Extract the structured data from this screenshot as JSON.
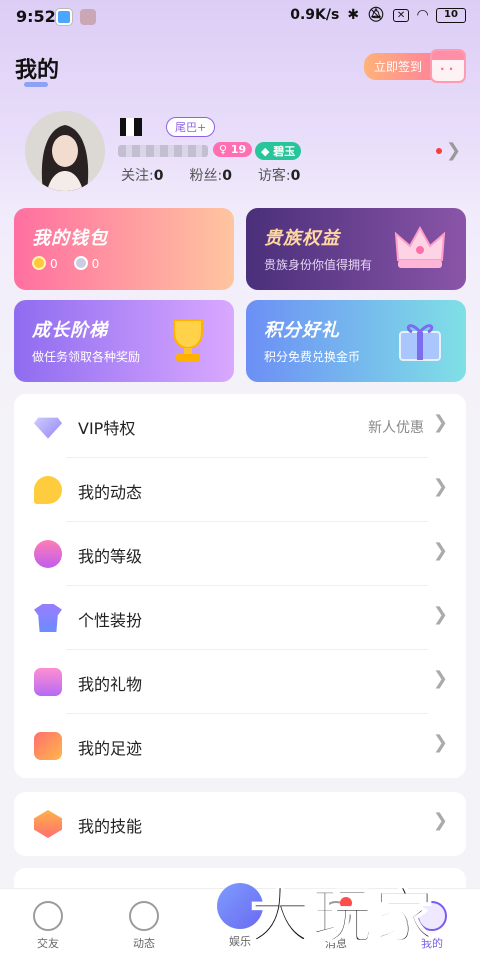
{
  "status_bar": {
    "time": "9:52",
    "net_speed": "0.9K/s",
    "battery": "10"
  },
  "header": {
    "title": "我的",
    "checkin_label": "立即签到"
  },
  "profile": {
    "tag": "尾巴+",
    "level_badge": "19",
    "jade_badge": "碧玉",
    "follow_label": "关注:",
    "follow_count": "0",
    "fans_label": "粉丝:",
    "fans_count": "0",
    "visitor_label": "访客:",
    "visitor_count": "0"
  },
  "cards": {
    "wallet": {
      "title": "我的钱包",
      "gold": "0",
      "silver": "0"
    },
    "noble": {
      "title": "贵族权益",
      "subtitle": "贵族身份你值得拥有"
    },
    "growth": {
      "title": "成长阶梯",
      "subtitle": "做任务领取各种奖励"
    },
    "points": {
      "title": "积分好礼",
      "subtitle": "积分免费兑换金币"
    }
  },
  "menu": [
    {
      "label": "VIP特权",
      "hint": "新人优惠",
      "icon": "diamond-icon"
    },
    {
      "label": "我的动态",
      "hint": "",
      "icon": "moments-icon"
    },
    {
      "label": "我的等级",
      "hint": "",
      "icon": "level-medal-icon"
    },
    {
      "label": "个性装扮",
      "hint": "",
      "icon": "outfit-icon"
    },
    {
      "label": "我的礼物",
      "hint": "",
      "icon": "gift-icon"
    },
    {
      "label": "我的足迹",
      "hint": "",
      "icon": "footprint-icon"
    }
  ],
  "menu2": [
    {
      "label": "我的技能",
      "icon": "skill-icon"
    }
  ],
  "tabs": [
    {
      "label": "交友",
      "icon": "heart-tab-icon"
    },
    {
      "label": "动态",
      "icon": "planet-tab-icon"
    },
    {
      "label": "娱乐",
      "icon": "house-tab-icon"
    },
    {
      "label": "消息",
      "icon": "message-tab-icon"
    },
    {
      "label": "我的",
      "icon": "profile-tab-icon"
    }
  ],
  "watermark": "大玩家"
}
